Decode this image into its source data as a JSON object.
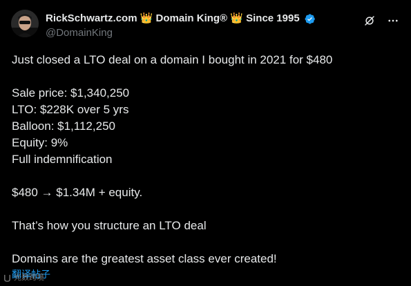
{
  "author": {
    "display_name": "RickSchwartz.com 👑 Domain King® 👑 Since 1995",
    "handle": "@DomainKing"
  },
  "icons": {
    "verified": "verified-badge-icon",
    "grok": "grok-icon",
    "more": "more-options-icon",
    "watermark": "watermark-logo-icon"
  },
  "colors": {
    "background": "#000000",
    "text": "#e7e9ea",
    "secondary": "#71767b",
    "accent": "#1d9bf0"
  },
  "tweet": {
    "lines": [
      "Just closed a LTO deal on a domain I bought in 2021 for $480",
      "",
      "Sale price: $1,340,250",
      "LTO: $228K over 5 yrs",
      "Balloon: $1,112,250",
      "Equity: 9%",
      "Full indemnification",
      "",
      "$480 → $1.34M + equity.",
      "",
      "That’s how you structure an LTO deal",
      "",
      "Domains are the greatest asset class ever created!"
    ],
    "translate_label": "翻译帖子"
  },
  "watermark": {
    "text": "光数跨境"
  }
}
